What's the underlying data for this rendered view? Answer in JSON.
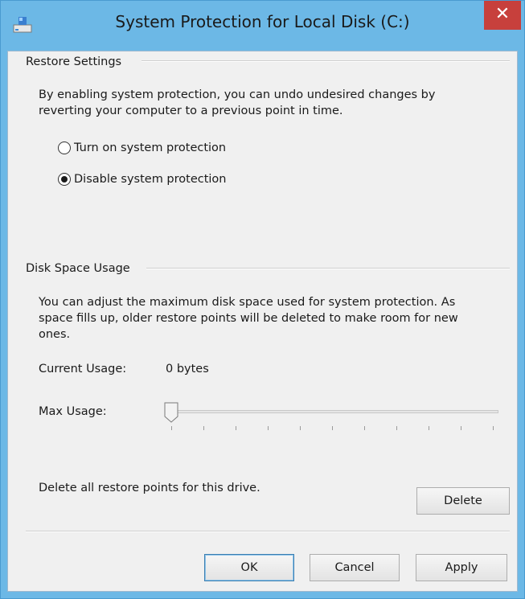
{
  "window": {
    "title": "System Protection for Local Disk (C:)",
    "close_glyph": "✕",
    "icon": "system-protection-drive-icon",
    "frame_color": "#6cb8e6",
    "close_color": "#c7403c"
  },
  "restore_settings": {
    "header": "Restore Settings",
    "description": "By enabling system protection, you can undo undesired changes by reverting your computer to a previous point in time.",
    "options": [
      {
        "label": "Turn on system protection",
        "selected": false
      },
      {
        "label": "Disable system protection",
        "selected": true
      }
    ]
  },
  "disk_space": {
    "header": "Disk Space Usage",
    "description": "You can adjust the maximum disk space used for system protection. As space fills up, older restore points will be deleted to make room for new ones.",
    "current_usage_label": "Current Usage:",
    "current_usage_value": "0 bytes",
    "max_usage_label": "Max Usage:",
    "max_usage_fraction": 0,
    "delete_text": "Delete all restore points for this drive.",
    "delete_button": "Delete"
  },
  "buttons": {
    "ok": "OK",
    "cancel": "Cancel",
    "apply": "Apply"
  }
}
